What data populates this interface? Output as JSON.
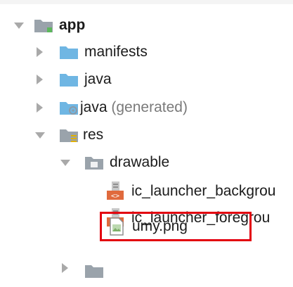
{
  "tree": {
    "app": {
      "label": "app"
    },
    "manifests": {
      "label": "manifests"
    },
    "java": {
      "label": "java"
    },
    "java_generated": {
      "label": "java",
      "suffix": "(generated)"
    },
    "res": {
      "label": "res"
    },
    "drawable": {
      "label": "drawable"
    },
    "ic_launcher_background": {
      "label": "ic_launcher_backgrou"
    },
    "ic_launcher_foreground": {
      "label": "ic_launcher_foregrou"
    },
    "umy": {
      "label": "umy.png"
    }
  },
  "colors": {
    "folder_blue": "#6fb6e3",
    "folder_gray": "#9aa3ab",
    "arrow_gray": "#a9a9a9",
    "highlight_red": "#e3000f",
    "xml_orange": "#e06a3d",
    "module_green": "#5cb85c"
  }
}
